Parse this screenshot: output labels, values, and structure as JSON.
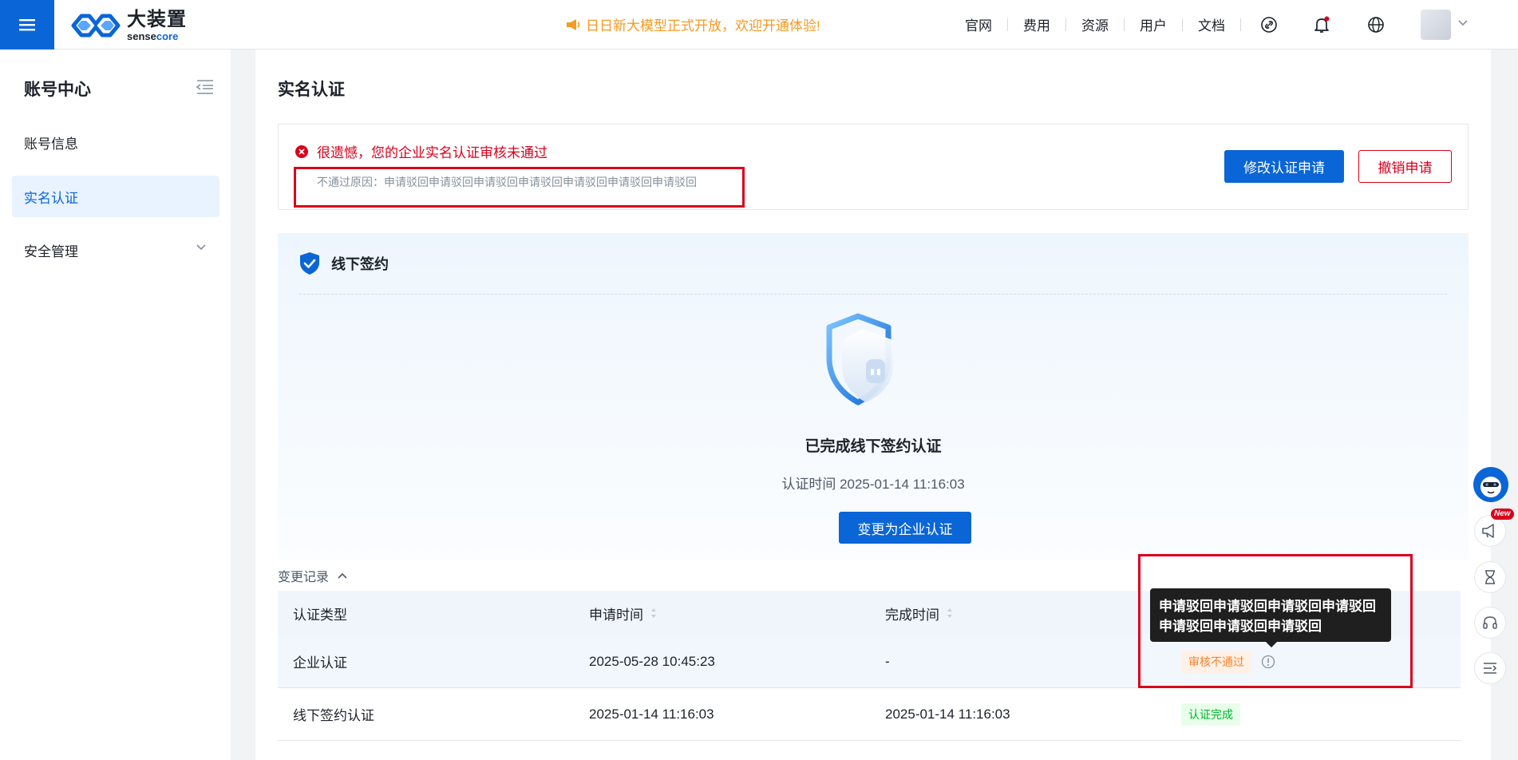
{
  "header": {
    "logo_cn": "大装置",
    "logo_en_prefix": "sense",
    "logo_en_suffix": "core",
    "announcement": "日日新大模型正式开放，欢迎开通体验!",
    "nav": [
      "官网",
      "费用",
      "资源",
      "用户",
      "文档"
    ]
  },
  "sidebar": {
    "title": "账号中心",
    "items": [
      {
        "label": "账号信息"
      },
      {
        "label": "实名认证"
      },
      {
        "label": "安全管理"
      }
    ]
  },
  "main": {
    "title": "实名认证",
    "alert": {
      "message": "很遗憾，您的企业实名认证审核未通过",
      "reason": "不通过原因：申请驳回申请驳回申请驳回申请驳回申请驳回申请驳回申请驳回",
      "edit_button": "修改认证申请",
      "cancel_button": "撤销申请"
    },
    "offline": {
      "title": "线下签约",
      "done_text": "已完成线下签约认证",
      "time_label": "认证时间",
      "time_value": "2025-01-14 11:16:03",
      "change_button": "变更为企业认证"
    },
    "history_label": "变更记录",
    "table": {
      "headers": [
        "认证类型",
        "申请时间",
        "完成时间",
        ""
      ],
      "rows": [
        {
          "type": "企业认证",
          "apply_time": "2025-05-28 10:45:23",
          "done_time": "-",
          "status": "审核不通过"
        },
        {
          "type": "线下签约认证",
          "apply_time": "2025-01-14 11:16:03",
          "done_time": "2025-01-14 11:16:03",
          "status": "认证完成"
        }
      ]
    },
    "tooltip": "申请驳回申请驳回申请驳回申请驳回申请驳回申请驳回申请驳回"
  },
  "float": {
    "new_badge": "New"
  },
  "colors": {
    "primary": "#0a66d6",
    "danger": "#d9001b",
    "warning": "#f59a23",
    "success": "#00b42a"
  }
}
